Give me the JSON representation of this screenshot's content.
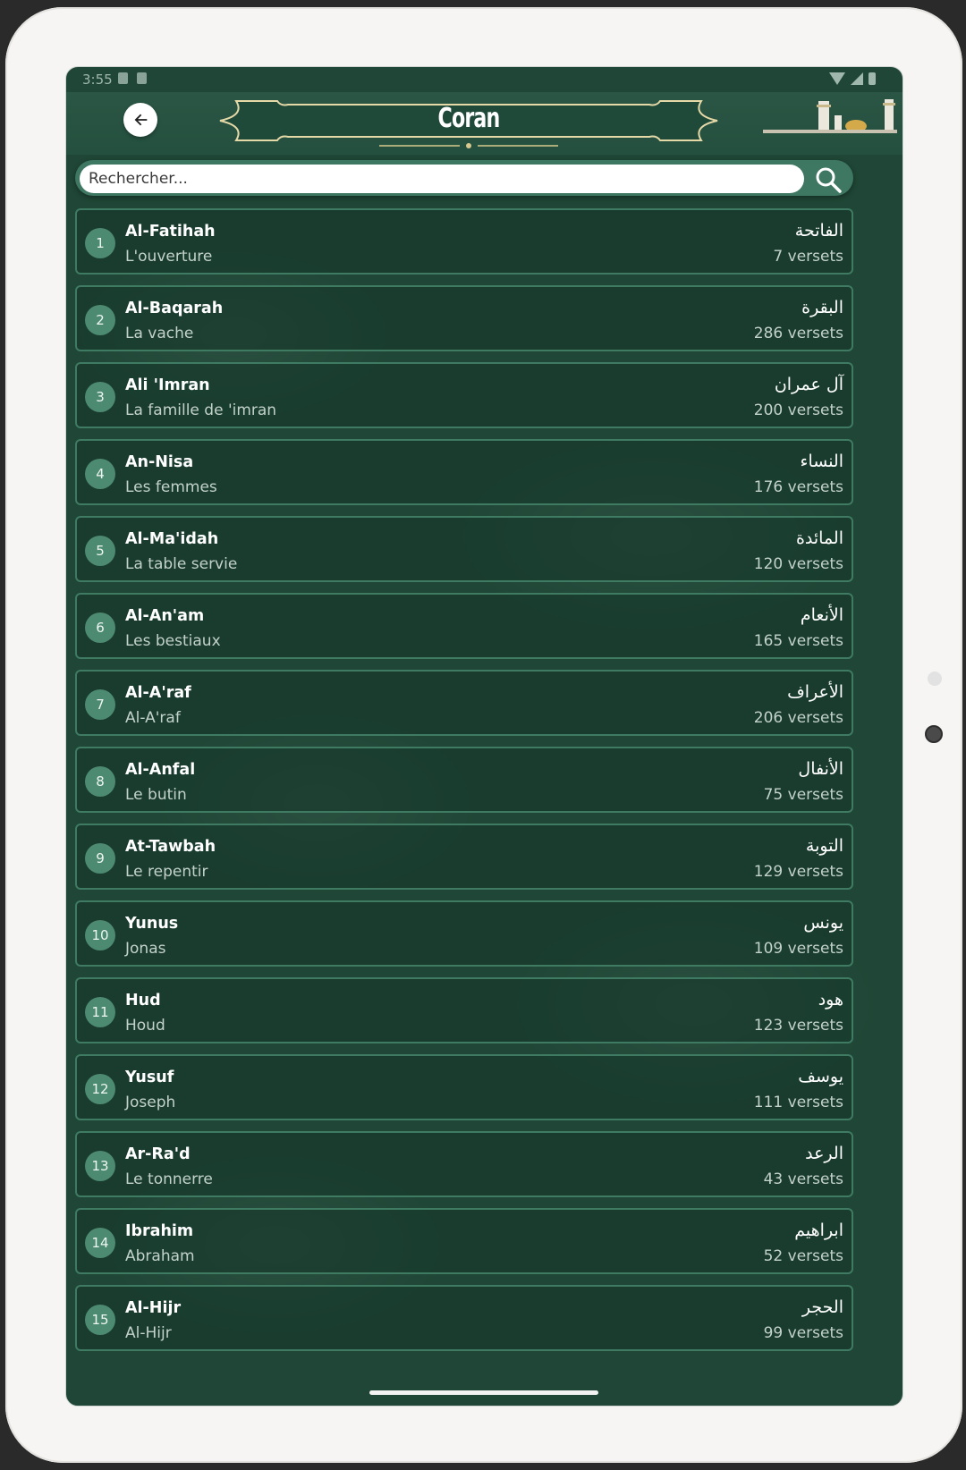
{
  "status_bar": {
    "time": "3:55"
  },
  "header": {
    "title": "Coran",
    "back_icon": "arrow-left-icon"
  },
  "search": {
    "placeholder": "Rechercher...",
    "icon": "search-icon"
  },
  "colors": {
    "background": "#1f4636",
    "accent": "#4d8a72",
    "border": "#3f7a63"
  },
  "surahs": [
    {
      "number": "1",
      "name": "Al-Fatihah",
      "translation": "L'ouverture",
      "arabic": "الفاتحة",
      "verses": "7 versets"
    },
    {
      "number": "2",
      "name": "Al-Baqarah",
      "translation": "La vache",
      "arabic": "البقرة",
      "verses": "286 versets"
    },
    {
      "number": "3",
      "name": "Ali 'Imran",
      "translation": "La famille de 'imran",
      "arabic": "آل عمران",
      "verses": "200 versets"
    },
    {
      "number": "4",
      "name": "An-Nisa",
      "translation": "Les femmes",
      "arabic": "النساء",
      "verses": "176 versets"
    },
    {
      "number": "5",
      "name": "Al-Ma'idah",
      "translation": "La table servie",
      "arabic": "المائدة",
      "verses": "120 versets"
    },
    {
      "number": "6",
      "name": "Al-An'am",
      "translation": "Les bestiaux",
      "arabic": "الأنعام",
      "verses": "165 versets"
    },
    {
      "number": "7",
      "name": "Al-A'raf",
      "translation": "Al-A'raf",
      "arabic": "الأعراف",
      "verses": "206 versets"
    },
    {
      "number": "8",
      "name": "Al-Anfal",
      "translation": "Le butin",
      "arabic": "الأنفال",
      "verses": "75 versets"
    },
    {
      "number": "9",
      "name": "At-Tawbah",
      "translation": "Le repentir",
      "arabic": "التوبة",
      "verses": "129 versets"
    },
    {
      "number": "10",
      "name": "Yunus",
      "translation": "Jonas",
      "arabic": "يونس",
      "verses": "109 versets"
    },
    {
      "number": "11",
      "name": "Hud",
      "translation": "Houd",
      "arabic": "هود",
      "verses": "123 versets"
    },
    {
      "number": "12",
      "name": "Yusuf",
      "translation": "Joseph",
      "arabic": "يوسف",
      "verses": "111 versets"
    },
    {
      "number": "13",
      "name": "Ar-Ra'd",
      "translation": "Le tonnerre",
      "arabic": "الرعد",
      "verses": "43 versets"
    },
    {
      "number": "14",
      "name": "Ibrahim",
      "translation": "Abraham",
      "arabic": "ابراهيم",
      "verses": "52 versets"
    },
    {
      "number": "15",
      "name": "Al-Hijr",
      "translation": "Al-Hijr",
      "arabic": "الحجر",
      "verses": "99 versets"
    }
  ]
}
